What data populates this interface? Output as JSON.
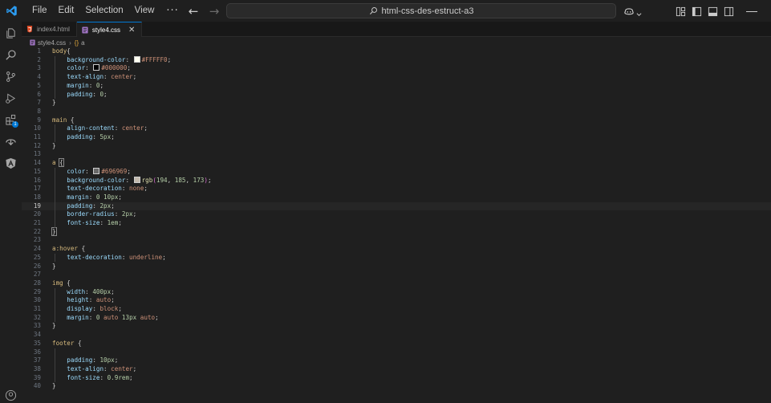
{
  "menu": {
    "file": "File",
    "edit": "Edit",
    "selection": "Selection",
    "view": "View",
    "more": "···"
  },
  "search": {
    "label": "html-css-des-estruct-a3"
  },
  "tabs": [
    {
      "label": "index4.html",
      "icon": "html5-icon",
      "active": false
    },
    {
      "label": "style4.css",
      "icon": "css-file-icon",
      "active": true
    }
  ],
  "breadcrumb": {
    "file": "style4.css",
    "symbol": "a"
  },
  "activity_bar": [
    {
      "icon": "explorer-icon"
    },
    {
      "icon": "search-icon"
    },
    {
      "icon": "source-control-icon"
    },
    {
      "icon": "run-debug-icon"
    },
    {
      "icon": "extensions-icon",
      "badge": "1"
    },
    {
      "icon": "remote-explorer-icon"
    },
    {
      "icon": "angular-icon"
    },
    {
      "icon": "account-icon"
    }
  ],
  "colors": {
    "accent": "#0078d4",
    "selector": "#d7ba7d",
    "property": "#9cdcfe",
    "value": "#ce9178",
    "number": "#b5cea8"
  },
  "editor": {
    "current_line": 19,
    "lines": [
      {
        "n": "1",
        "code": "body{"
      },
      {
        "n": "2",
        "code": "    background-color: #FFFFF0;"
      },
      {
        "n": "3",
        "code": "    color: #000000;"
      },
      {
        "n": "4",
        "code": "    text-align: center;"
      },
      {
        "n": "5",
        "code": "    margin: 0;"
      },
      {
        "n": "6",
        "code": "    padding: 0;"
      },
      {
        "n": "7",
        "code": "}"
      },
      {
        "n": "8",
        "code": ""
      },
      {
        "n": "9",
        "code": "main {"
      },
      {
        "n": "10",
        "code": "    align-content: center;"
      },
      {
        "n": "11",
        "code": "    padding: 5px;"
      },
      {
        "n": "12",
        "code": "}"
      },
      {
        "n": "13",
        "code": ""
      },
      {
        "n": "14",
        "code": "a {"
      },
      {
        "n": "15",
        "code": "    color: #696969;"
      },
      {
        "n": "16",
        "code": "    background-color: rgb(194, 185, 173);"
      },
      {
        "n": "17",
        "code": "    text-decoration: none;"
      },
      {
        "n": "18",
        "code": "    margin: 0 10px;"
      },
      {
        "n": "19",
        "code": "    padding: 2px;"
      },
      {
        "n": "20",
        "code": "    border-radius: 2px;"
      },
      {
        "n": "21",
        "code": "    font-size: 1em;"
      },
      {
        "n": "22",
        "code": "}"
      },
      {
        "n": "23",
        "code": ""
      },
      {
        "n": "24",
        "code": "a:hover {"
      },
      {
        "n": "25",
        "code": "    text-decoration: underline;"
      },
      {
        "n": "26",
        "code": "}"
      },
      {
        "n": "27",
        "code": ""
      },
      {
        "n": "28",
        "code": "img {"
      },
      {
        "n": "29",
        "code": "    width: 400px;"
      },
      {
        "n": "30",
        "code": "    height: auto;"
      },
      {
        "n": "31",
        "code": "    display: block;"
      },
      {
        "n": "32",
        "code": "    margin: 0 auto 13px auto;"
      },
      {
        "n": "33",
        "code": "}"
      },
      {
        "n": "34",
        "code": ""
      },
      {
        "n": "35",
        "code": "footer {"
      },
      {
        "n": "36",
        "code": ""
      },
      {
        "n": "37",
        "code": "    padding: 10px;"
      },
      {
        "n": "38",
        "code": "    text-align: center;"
      },
      {
        "n": "39",
        "code": "    font-size: 0.9rem;"
      },
      {
        "n": "40",
        "code": "}"
      }
    ]
  }
}
